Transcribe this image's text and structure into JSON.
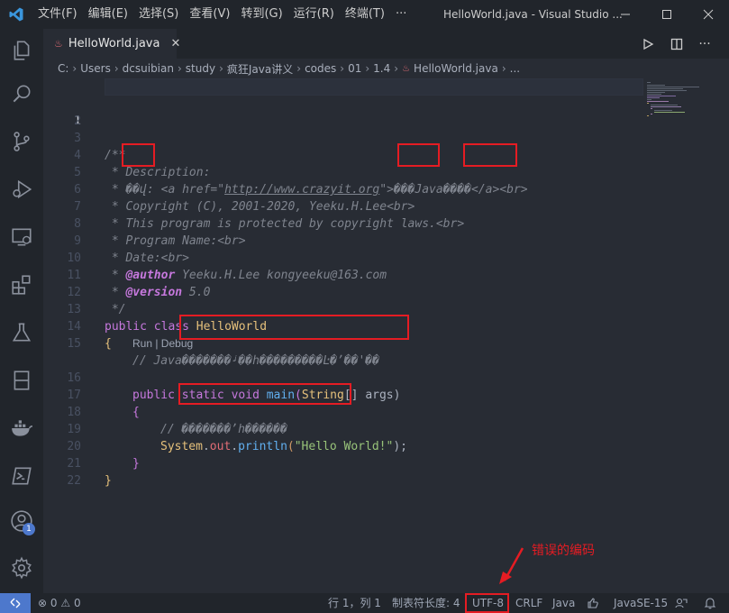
{
  "titlebar": {
    "menus": [
      "文件(F)",
      "编辑(E)",
      "选择(S)",
      "查看(V)",
      "转到(G)",
      "运行(R)",
      "终端(T)",
      "···"
    ],
    "title": "HelloWorld.java - Visual Studio ..."
  },
  "tab": {
    "label": "HelloWorld.java"
  },
  "breadcrumb": [
    "C:",
    "Users",
    "dcsuibian",
    "study",
    "疯狂Java讲义",
    "codes",
    "01",
    "1.4",
    "HelloWorld.java",
    "..."
  ],
  "editor": {
    "line_numbers": [
      "1",
      "2",
      "3",
      "4",
      "5",
      "6",
      "7",
      "8",
      "9",
      "10",
      "11",
      "12",
      "13",
      "14",
      "15",
      "16",
      "17",
      "18",
      "19",
      "20",
      "21",
      "22"
    ],
    "l3": "/**",
    "l4": " * Description:",
    "l5_a": " * ",
    "l5_b": "��",
    "l5_c": "վ: <a href=\"",
    "l5_url": "http://www.crazyit.org",
    "l5_d": "\">",
    "l5_e": "���",
    "l5_f": "Java",
    "l5_g": "����",
    "l5_h": "</a><br>",
    "l6": " * Copyright (C), 2001-2020, Yeeku.H.Lee<br>",
    "l7": " * This program is protected by copyright laws.<br>",
    "l8": " * Program Name:<br>",
    "l9": " * Date:<br>",
    "l10_pre": " * ",
    "l10_ann": "@author",
    "l10_post": " Yeeku.H.Lee kongyeeku@163.com",
    "l11_pre": " * ",
    "l11_ann": "@version",
    "l11_post": " 5.0",
    "l12": " */",
    "l13_kw1": "public",
    "l13_kw2": "class",
    "l13_cls": "HelloWorld",
    "l14": "{",
    "l15_a": "// Java",
    "l15_b": "�������ᶨ��һ���������Ŀ�ʼ��'��",
    "codelens": "Run | Debug",
    "l16_kw1": "public",
    "l16_kw2": "static",
    "l16_kw3": "void",
    "l16_fn": "main",
    "l16_p1": "(",
    "l16_ty": "String",
    "l16_p2": "[] args)",
    "l17": "{",
    "l18_a": "// ",
    "l18_b": "�������ʼh������",
    "l19_obj": "System",
    "l19_dot1": ".",
    "l19_out": "out",
    "l19_dot2": ".",
    "l19_fn": "println",
    "l19_p1": "(",
    "l19_str": "\"Hello World!\"",
    "l19_p2": ");",
    "l20": "}",
    "l21": "}"
  },
  "statusbar": {
    "errors": "0",
    "warnings": "0",
    "position": "行 1，列 1",
    "tab_size": "制表符长度: 4",
    "encoding": "UTF-8",
    "eol": "CRLF",
    "language": "Java",
    "java_version": "JavaSE-15",
    "notifications_badge": "1"
  },
  "annotation": {
    "text": "错误的编码"
  },
  "colors": {
    "annotation_red": "#e51c23",
    "accent_blue": "#4d78cc"
  }
}
